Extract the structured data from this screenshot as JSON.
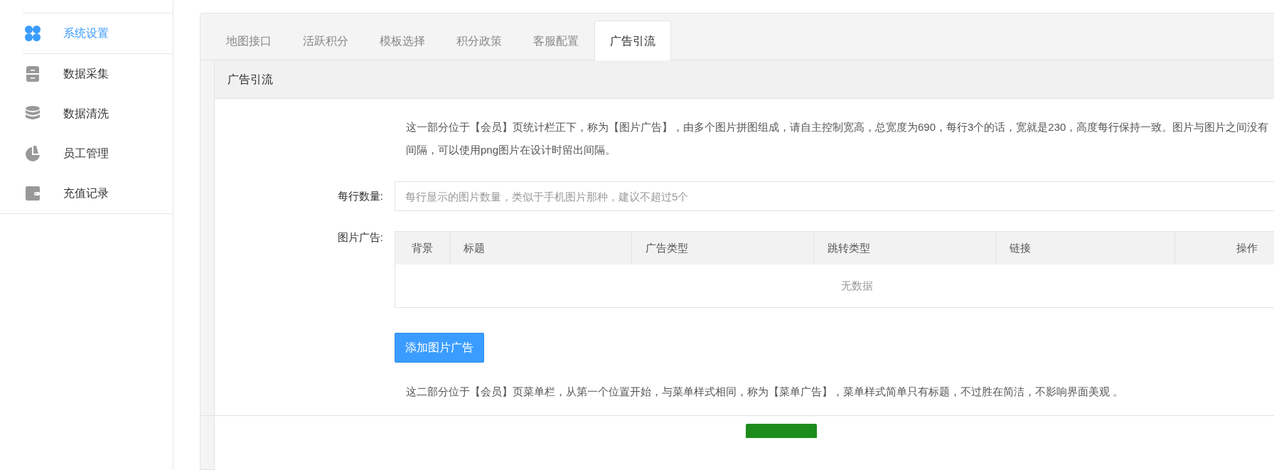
{
  "sidebar": {
    "items": [
      {
        "label": "系统设置",
        "selected": true
      },
      {
        "label": "数据采集",
        "selected": false
      },
      {
        "label": "数据清洗",
        "selected": false
      },
      {
        "label": "员工管理",
        "selected": false
      },
      {
        "label": "充值记录",
        "selected": false
      }
    ]
  },
  "tabs": [
    {
      "label": "地图接口",
      "selected": false
    },
    {
      "label": "活跃积分",
      "selected": false
    },
    {
      "label": "模板选择",
      "selected": false
    },
    {
      "label": "积分政策",
      "selected": false
    },
    {
      "label": "客服配置",
      "selected": false
    },
    {
      "label": "广告引流",
      "selected": true
    }
  ],
  "section_title": "广告引流",
  "description": "这一部分位于【会员】页统计栏正下，称为【图片广告】，由多个图片拼图组成，请自主控制宽高，总宽度为690，每行3个的话，宽就是230，高度每行保持一致。图片与图片之间没有间隔，可以使用png图片在设计时留出间隔。",
  "per_row": {
    "label": "每行数量:",
    "placeholder": "每行显示的图片数量，类似于手机图片那种，建议不超过5个"
  },
  "image_ads": {
    "label": "图片广告:",
    "columns": [
      "背景",
      "标题",
      "广告类型",
      "跳转类型",
      "链接",
      "操作"
    ],
    "empty_text": "无数据",
    "add_button": "添加图片广告"
  },
  "menu_note": "这二部分位于【会员】页菜单栏，从第一个位置开始，与菜单样式相同，称为【菜单广告】，菜单样式简单只有标题，不过胜在简洁，不影响界面美观 。"
}
